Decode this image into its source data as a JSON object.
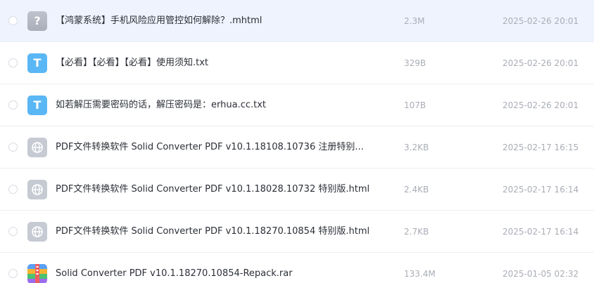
{
  "files": [
    {
      "name": "【鸿蒙系统】手机风险应用管控如何解除？.mhtml",
      "size": "2.3M",
      "date": "2025-02-26 20:01",
      "icon": "unknown-file-icon",
      "icon_glyph": "?",
      "selected": true
    },
    {
      "name": "【必看】【必看】【必看】使用须知.txt",
      "size": "329B",
      "date": "2025-02-26 20:01",
      "icon": "txt-file-icon",
      "icon_glyph": "T"
    },
    {
      "name": "如若解压需要密码的话，解压密码是：erhua.cc.txt",
      "size": "107B",
      "date": "2025-02-26 20:01",
      "icon": "txt-file-icon",
      "icon_glyph": "T"
    },
    {
      "name": "PDF文件转换软件 Solid Converter PDF v10.1.18108.10736 注册特别...",
      "size": "3.2KB",
      "date": "2025-02-17 16:15",
      "icon": "globe-html-icon"
    },
    {
      "name": "PDF文件转换软件 Solid Converter PDF v10.1.18028.10732 特别版.html",
      "size": "2.4KB",
      "date": "2025-02-17 16:14",
      "icon": "globe-html-icon"
    },
    {
      "name": "PDF文件转换软件 Solid Converter PDF v10.1.18270.10854 特别版.html",
      "size": "2.7KB",
      "date": "2025-02-17 16:14",
      "icon": "globe-html-icon"
    },
    {
      "name": "Solid Converter PDF v10.1.18270.10854-Repack.rar",
      "size": "133.4M",
      "date": "2025-01-05 02:32",
      "icon": "rar-archive-icon"
    }
  ]
}
